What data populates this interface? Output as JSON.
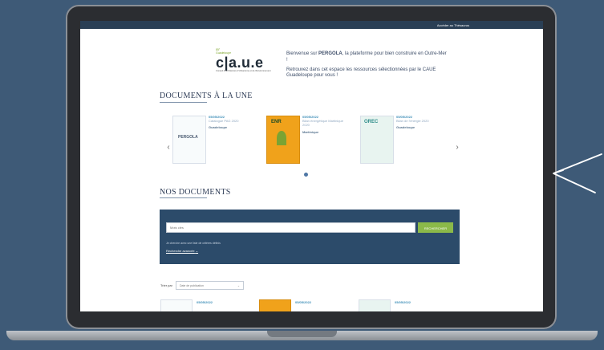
{
  "topbar": {
    "link": "Accéder au Thésaurus"
  },
  "logo": {
    "small1": "85°",
    "small2": "Guadeloupe",
    "main": "c|a.u.e",
    "sub": "Conseil d'Architecture d'Urbanisme et de l'Environnement"
  },
  "intro": {
    "p1_prefix": "Bienvenue sur ",
    "p1_brand": "PERGOLA",
    "p1_suffix": ", la plateforme pour bien construire en Outre-Mer !",
    "p2": "Retrouvez dans cet espace les ressources sélectionnées par le CAUE Guadeloupe pour vous !"
  },
  "sections": {
    "featured": "DOCUMENTS À LA UNE",
    "all": "NOS DOCUMENTS"
  },
  "featured_docs": [
    {
      "date": "05/05/2022",
      "title": "Catalogue PAG 2020",
      "source": "Guadeloupe",
      "thumb": "PERGOLA"
    },
    {
      "date": "05/05/2022",
      "title": "Bilan énergétique Martinique 2020",
      "source": "Martinique",
      "thumb": "ENR"
    },
    {
      "date": "05/05/2022",
      "title": "Bilan de l'énergie 2020",
      "source": "Guadeloupe",
      "thumb": "OREC"
    }
  ],
  "search": {
    "placeholder": "Mots clés",
    "button": "RECHERCHER",
    "help": "Je cherche avec une liste de critères définis",
    "advanced": "Recherche avancée"
  },
  "sort": {
    "label": "Trier par",
    "selected": "Date de publication"
  },
  "list_docs": [
    {
      "date": "05/05/2022"
    },
    {
      "date": "05/05/2022"
    },
    {
      "date": "05/05/2022"
    }
  ]
}
